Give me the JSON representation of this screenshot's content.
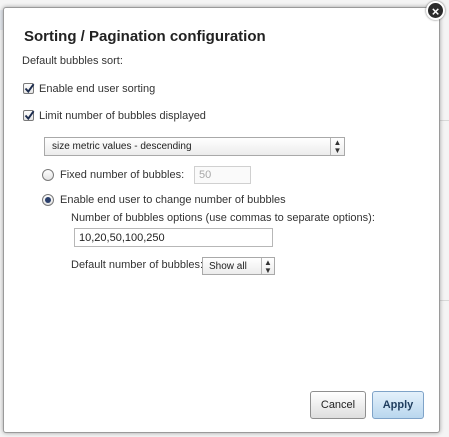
{
  "dialog": {
    "title": "Sorting / Pagination configuration",
    "close_symbol": "×",
    "default_sort_label": "Default bubbles sort:",
    "enable_sorting": {
      "label": "Enable end user sorting",
      "checked": true
    },
    "limit_bubbles": {
      "label": "Limit number of bubbles displayed",
      "checked": true
    },
    "sort_select": {
      "value": "size metric values - descending"
    },
    "fixed_number": {
      "label": "Fixed number of bubbles:",
      "selected": false,
      "value": "50"
    },
    "enable_change": {
      "label": "Enable end user to change number of bubbles",
      "selected": true
    },
    "options_label": "Number of bubbles options (use commas to separate options):",
    "options_value": "10,20,50,100,250",
    "default_number_label": "Default number of bubbles:",
    "default_number_select": {
      "value": "Show all"
    },
    "buttons": {
      "cancel": "Cancel",
      "apply": "Apply"
    }
  },
  "icons": {
    "close": "close-icon",
    "check": "checkmark-icon",
    "dropdown": "double-chevron-icon"
  }
}
